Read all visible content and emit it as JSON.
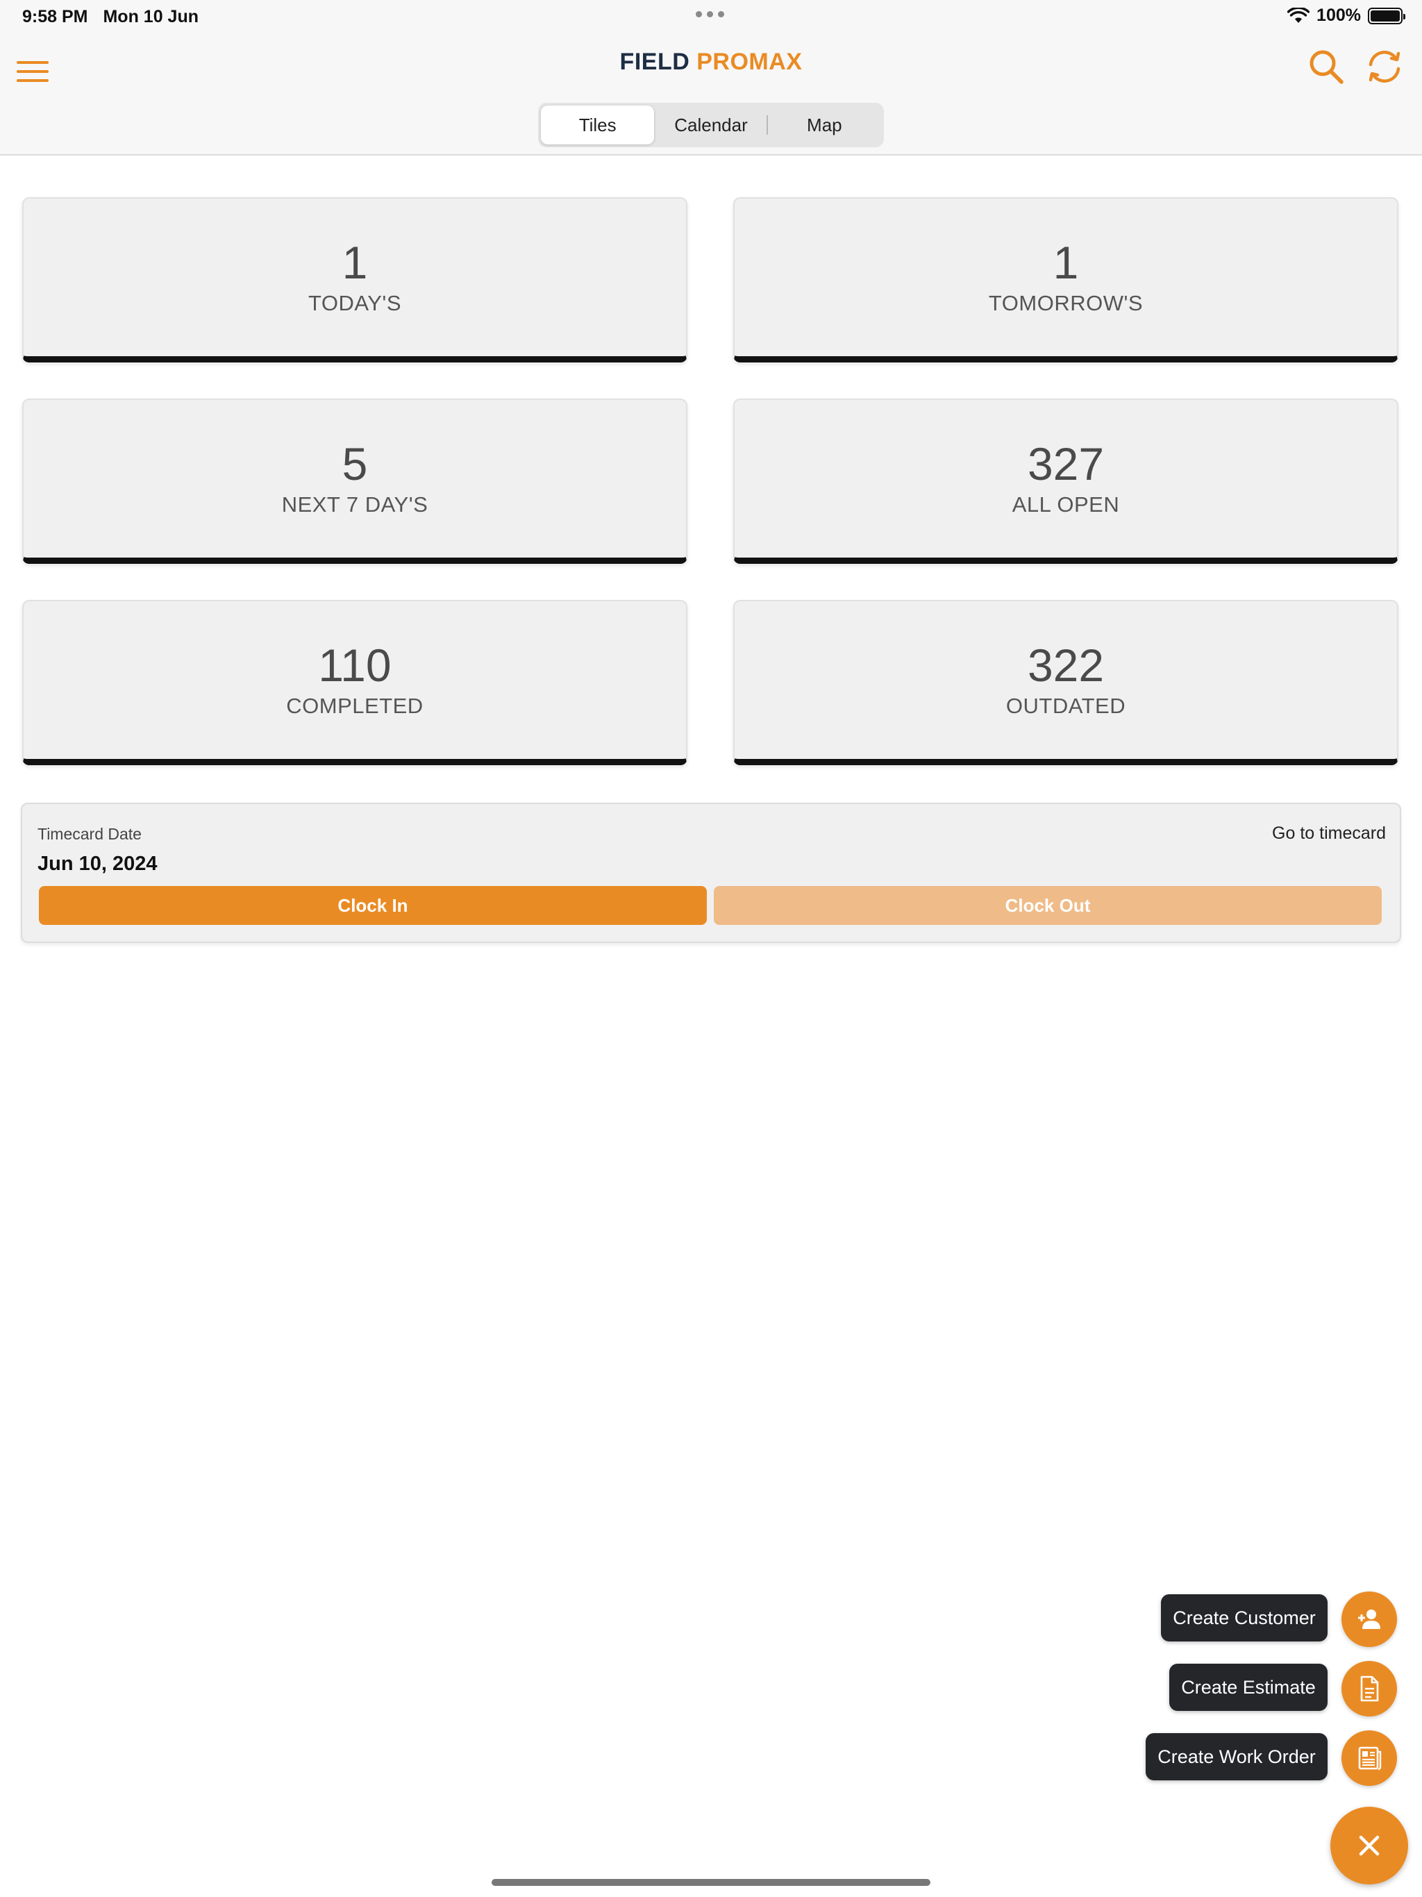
{
  "status_bar": {
    "time": "9:58 PM",
    "date": "Mon 10 Jun",
    "battery": "100%"
  },
  "header": {
    "brand_part1": "FIELD",
    "brand_part2": "PROMAX",
    "tabs": [
      {
        "label": "Tiles",
        "active": true
      },
      {
        "label": "Calendar",
        "active": false
      },
      {
        "label": "Map",
        "active": false
      }
    ],
    "icons": [
      "hamburger-icon",
      "search-icon",
      "sync-icon"
    ]
  },
  "tiles": [
    {
      "count": "1",
      "label": "TODAY'S"
    },
    {
      "count": "1",
      "label": "TOMORROW'S"
    },
    {
      "count": "5",
      "label": "NEXT 7 DAY'S"
    },
    {
      "count": "327",
      "label": "ALL OPEN"
    },
    {
      "count": "110",
      "label": "COMPLETED"
    },
    {
      "count": "322",
      "label": "OUTDATED"
    }
  ],
  "timecard": {
    "label": "Timecard Date",
    "date": "Jun 10, 2024",
    "link": "Go to timecard",
    "clock_in": "Clock In",
    "clock_out": "Clock Out"
  },
  "fab_menu": {
    "items": [
      {
        "label": "Create Customer",
        "icon": "add-user-icon"
      },
      {
        "label": "Create Estimate",
        "icon": "document-icon"
      },
      {
        "label": "Create Work Order",
        "icon": "work-order-icon"
      }
    ],
    "close_icon": "close-icon"
  },
  "colors": {
    "accent": "#e98b24",
    "accent_light": "#efbb88",
    "brand_dark": "#1d2d44",
    "tile_bg": "#f0f0f0",
    "tooltip_bg": "#24262a"
  }
}
